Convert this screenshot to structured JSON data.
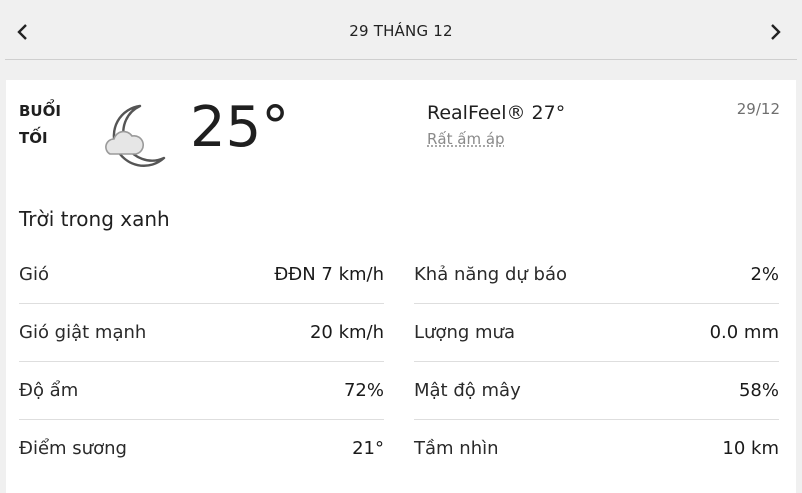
{
  "header": {
    "date_title": "29 THÁNG 12",
    "prev_icon": "chevron-left-icon",
    "next_icon": "chevron-right-icon"
  },
  "current": {
    "period_line1": "BUỔI",
    "period_line2": "TỐI",
    "weather_icon": "cloudy-moon-icon",
    "temperature": "25°",
    "realfeel": "RealFeel® 27°",
    "realfeel_desc": "Rất ấm áp",
    "date": "29/12",
    "phrase": "Trời trong xanh"
  },
  "details": {
    "left": [
      {
        "label": "Gió",
        "value": "ĐĐN 7 km/h"
      },
      {
        "label": "Gió giật mạnh",
        "value": "20 km/h"
      },
      {
        "label": "Độ ẩm",
        "value": "72%"
      },
      {
        "label": "Điểm sương",
        "value": "21°"
      }
    ],
    "right": [
      {
        "label": "Khả năng dự báo",
        "value": "2%"
      },
      {
        "label": "Lượng mưa",
        "value": "0.0 mm"
      },
      {
        "label": "Mật độ mây",
        "value": "58%"
      },
      {
        "label": "Tầm nhìn",
        "value": "10 km"
      }
    ]
  }
}
